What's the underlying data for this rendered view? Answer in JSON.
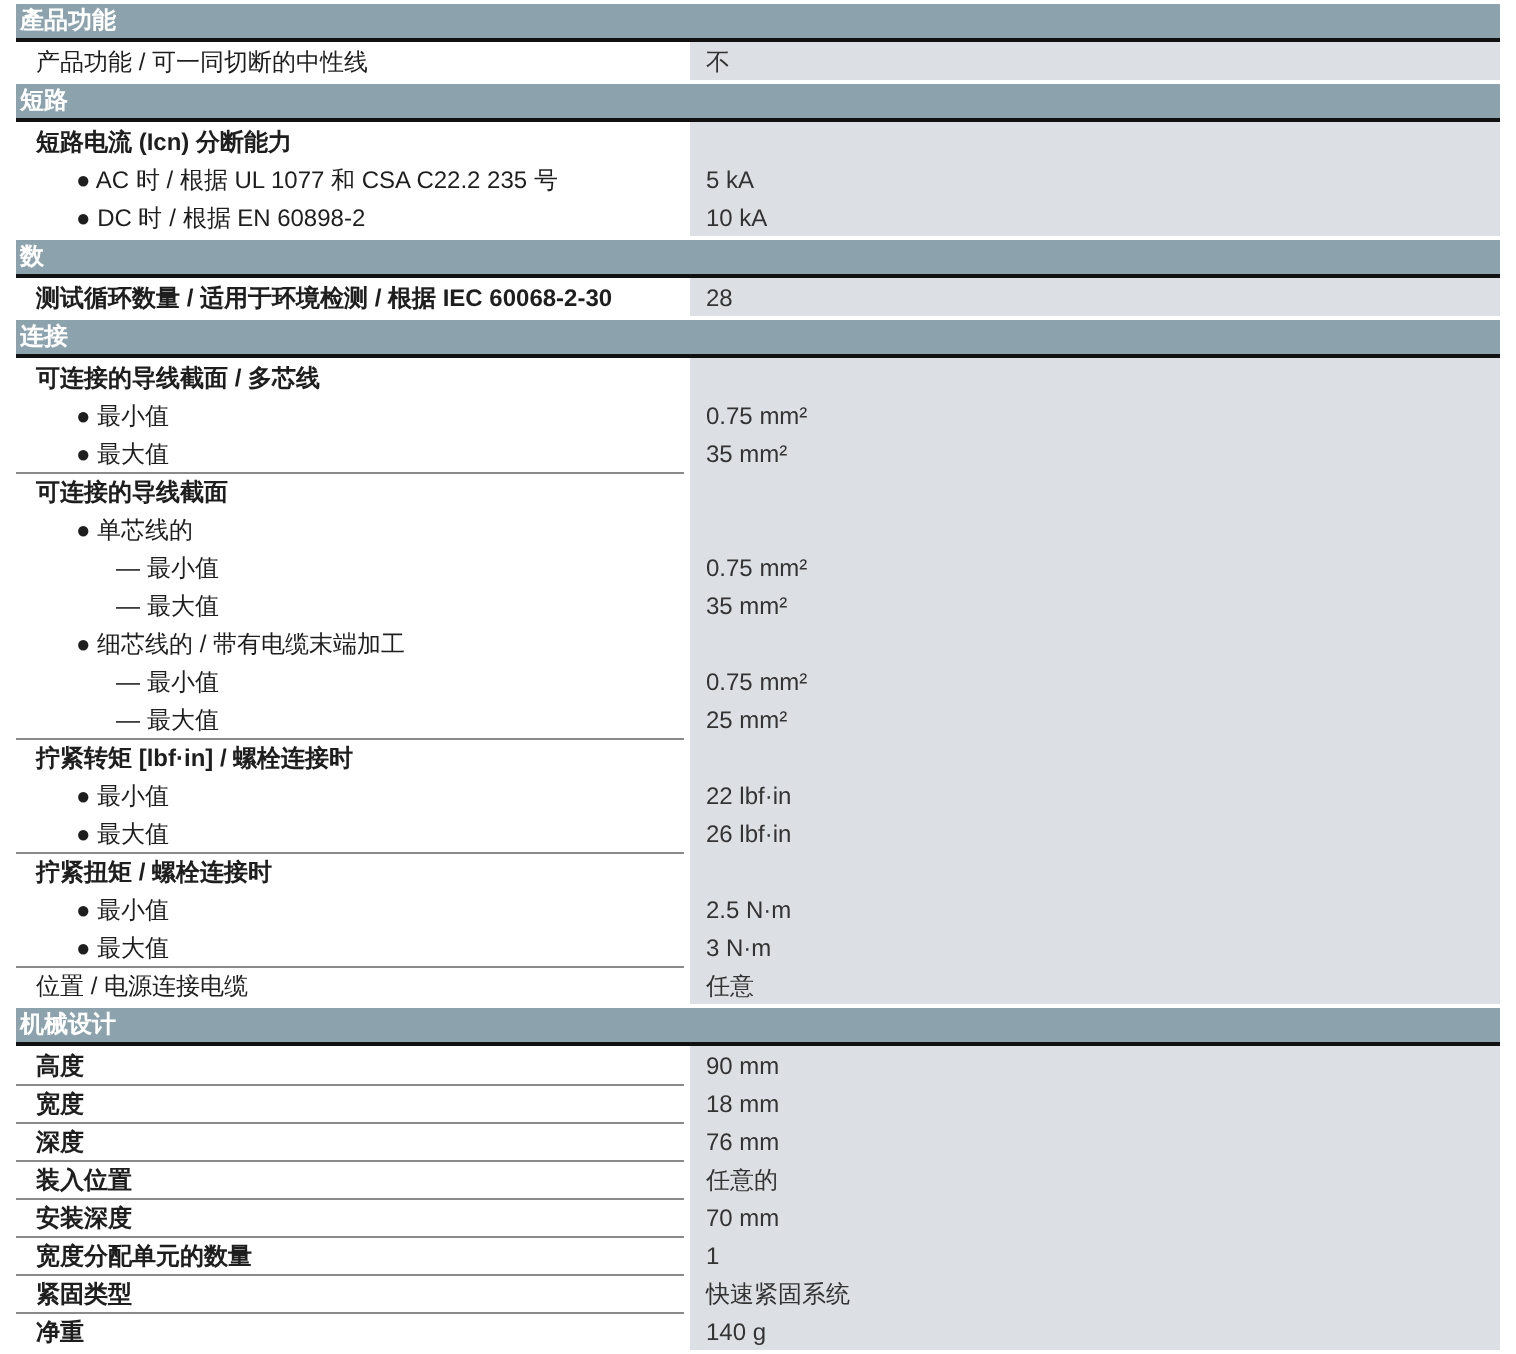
{
  "sections": [
    {
      "title": "產品功能",
      "items": [
        {
          "label": "产品功能 / 可一同切断的中性线",
          "bold": false,
          "value": "不"
        }
      ]
    },
    {
      "title": "短路",
      "items": [
        {
          "label": "短路电流 (Icn) 分断能力",
          "bold": true,
          "children": [
            {
              "label": "● AC 时 / 根据 UL 1077 和 CSA C22.2 235 号",
              "value": "5 kA"
            },
            {
              "label": "● DC 时 / 根据 EN 60898-2",
              "value": "10 kA"
            }
          ]
        }
      ]
    },
    {
      "title": "数",
      "items": [
        {
          "label": "测试循环数量 / 适用于环境检测 / 根据 IEC 60068-2-30",
          "bold": true,
          "value": "28"
        }
      ]
    },
    {
      "title": "连接",
      "items": [
        {
          "label": "可连接的导线截面 / 多芯线",
          "bold": true,
          "children": [
            {
              "label": "● 最小值",
              "value": "0.75 mm²"
            },
            {
              "label": "● 最大值",
              "value": "35 mm²"
            }
          ]
        },
        {
          "label": "可连接的导线截面",
          "bold": true,
          "children": [
            {
              "label": "● 单芯线的",
              "children": [
                {
                  "label": "— 最小值",
                  "value": "0.75 mm²"
                },
                {
                  "label": "— 最大值",
                  "value": "35 mm²"
                }
              ]
            },
            {
              "label": "● 细芯线的 / 带有电缆末端加工",
              "children": [
                {
                  "label": "— 最小值",
                  "value": "0.75 mm²"
                },
                {
                  "label": "— 最大值",
                  "value": "25 mm²"
                }
              ]
            }
          ]
        },
        {
          "label": "拧紧转矩 [lbf·in] / 螺栓连接时",
          "bold": true,
          "children": [
            {
              "label": "● 最小值",
              "value": "22 lbf·in"
            },
            {
              "label": "● 最大值",
              "value": "26 lbf·in"
            }
          ]
        },
        {
          "label": "拧紧扭矩 / 螺栓连接时",
          "bold": true,
          "children": [
            {
              "label": "● 最小值",
              "value": "2.5 N·m"
            },
            {
              "label": "● 最大值",
              "value": "3 N·m"
            }
          ]
        },
        {
          "label": "位置 / 电源连接电缆",
          "bold": false,
          "value": "任意"
        }
      ]
    },
    {
      "title": "机械设计",
      "items": [
        {
          "label": "高度",
          "bold": true,
          "value": "90 mm"
        },
        {
          "label": "宽度",
          "bold": true,
          "value": "18 mm"
        },
        {
          "label": "深度",
          "bold": true,
          "value": "76 mm"
        },
        {
          "label": "装入位置",
          "bold": true,
          "value": "任意的"
        },
        {
          "label": "安装深度",
          "bold": true,
          "value": "70 mm"
        },
        {
          "label": "宽度分配单元的数量",
          "bold": true,
          "value": "1"
        },
        {
          "label": "紧固类型",
          "bold": true,
          "value": "快速紧固系统"
        },
        {
          "label": "净重",
          "bold": true,
          "value": "140 g"
        }
      ]
    }
  ]
}
